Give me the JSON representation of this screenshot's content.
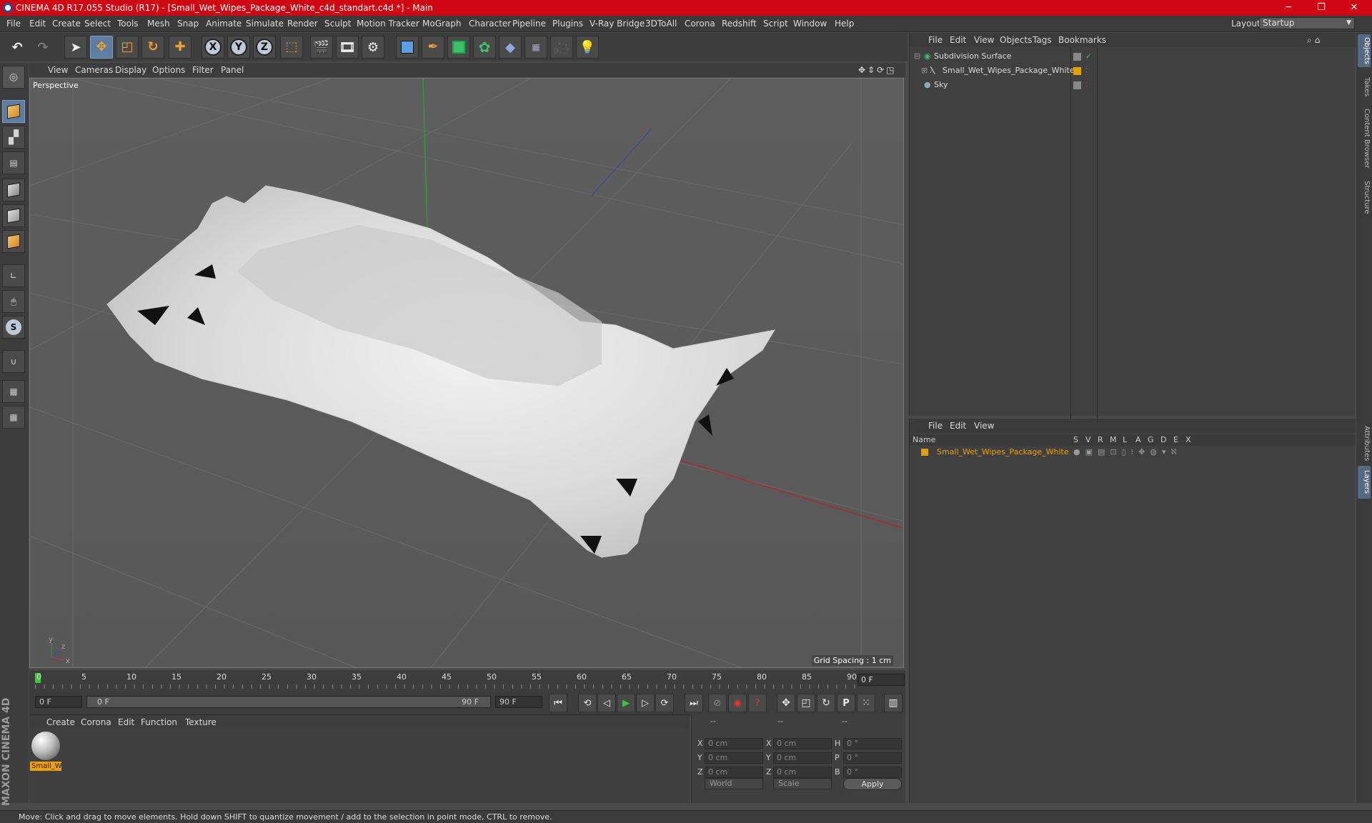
{
  "window": {
    "title": "CINEMA 4D R17.055 Studio (R17) - [Small_Wet_Wipes_Package_White_c4d_standart.c4d *] - Main"
  },
  "menu": [
    "File",
    "Edit",
    "Create",
    "Select",
    "Tools",
    "Mesh",
    "Snap",
    "Animate",
    "Simulate",
    "Render",
    "Sculpt",
    "Motion Tracker",
    "MoGraph",
    "Character",
    "Pipeline",
    "Plugins",
    "V-Ray Bridge",
    "3DToAll",
    "Corona",
    "Redshift",
    "Script",
    "Window",
    "Help"
  ],
  "layout": {
    "label": "Layout:",
    "value": "Startup"
  },
  "viewport": {
    "menu": [
      "View",
      "Cameras",
      "Display",
      "Options",
      "Filter",
      "Panel"
    ],
    "name": "Perspective",
    "grid_spacing": "Grid Spacing : 1 cm"
  },
  "timeline": {
    "ticks": [
      "0",
      "5",
      "10",
      "15",
      "20",
      "25",
      "30",
      "35",
      "40",
      "45",
      "50",
      "55",
      "60",
      "65",
      "70",
      "75",
      "80",
      "85",
      "90"
    ],
    "current_frame": "0 F",
    "start": "0 F",
    "range_start": "0 F",
    "range_end": "90 F",
    "end": "90 F"
  },
  "material_manager": {
    "menu": [
      "Create",
      "Corona",
      "Edit",
      "Function",
      "Texture"
    ],
    "material_label": "Small_W"
  },
  "coords": {
    "headers": [
      "--",
      "--",
      "--"
    ],
    "rows": [
      {
        "l1": "X",
        "v1": "0 cm",
        "l2": "X",
        "v2": "0 cm",
        "l3": "H",
        "v3": "0 °"
      },
      {
        "l1": "Y",
        "v1": "0 cm",
        "l2": "Y",
        "v2": "0 cm",
        "l3": "P",
        "v3": "0 °"
      },
      {
        "l1": "Z",
        "v1": "0 cm",
        "l2": "Z",
        "v2": "0 cm",
        "l3": "B",
        "v3": "0 °"
      }
    ],
    "world": "World",
    "scale": "Scale",
    "apply": "Apply"
  },
  "object_manager": {
    "menu": [
      "File",
      "Edit",
      "View",
      "Objects",
      "Tags",
      "Bookmarks"
    ],
    "objects": [
      "Subdivision Surface",
      "Small_Wet_Wipes_Package_White",
      "Sky"
    ]
  },
  "layer_manager": {
    "menu": [
      "File",
      "Edit",
      "View"
    ],
    "name_header": "Name",
    "columns": [
      "S",
      "V",
      "R",
      "M",
      "L",
      "A",
      "G",
      "D",
      "E",
      "X"
    ],
    "layer_name": "Small_Wet_Wipes_Package_White"
  },
  "right_tabs": [
    "Objects",
    "Takes",
    "Content Browser",
    "Structure",
    "Attributes",
    "Layers"
  ],
  "status": "Move: Click and drag to move elements. Hold down SHIFT to quantize movement / add to the selection in point mode, CTRL to remove.",
  "colors": {
    "title_bar": "#cf0712",
    "accent": "#f0a000",
    "selected_tool": "#5d7da1"
  }
}
